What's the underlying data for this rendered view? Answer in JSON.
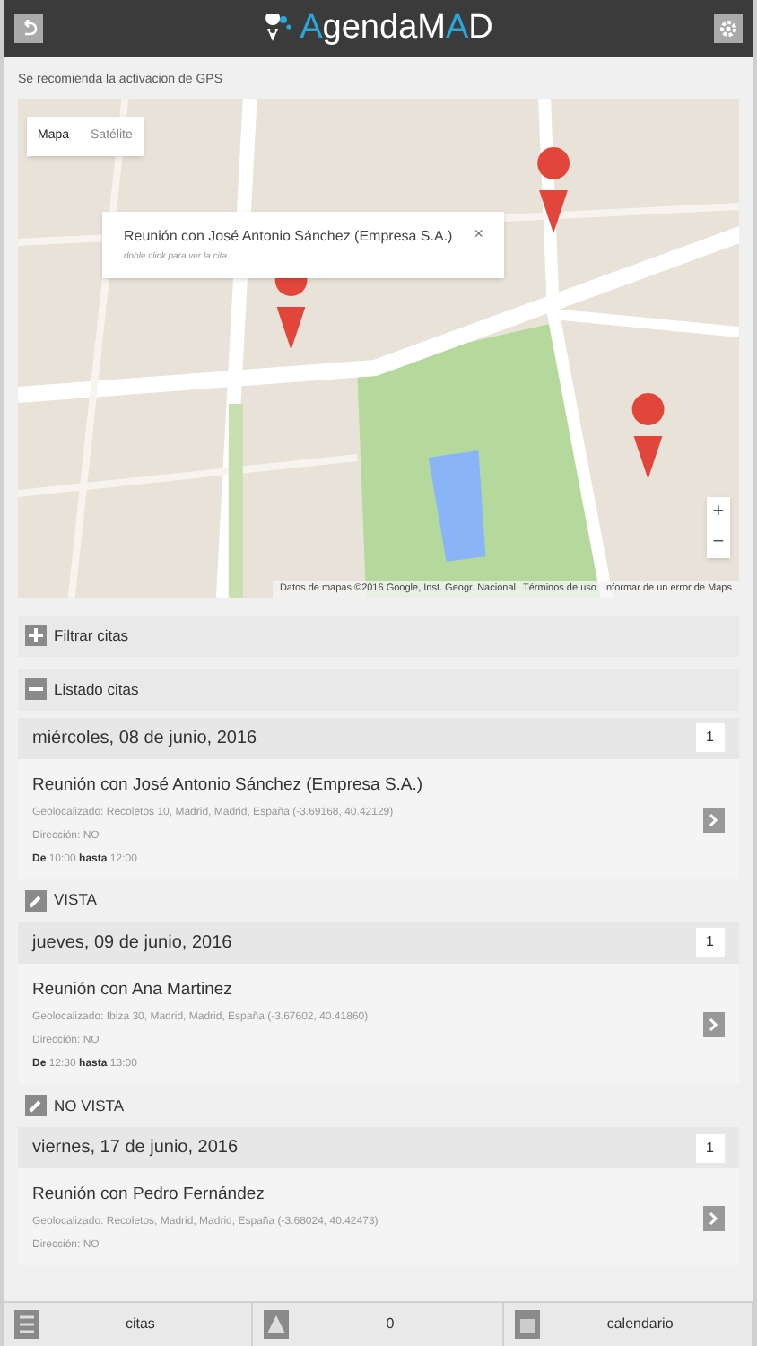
{
  "header": {
    "title_start": "A",
    "title_mid": "genda",
    "title_m": "M",
    "title_a": "A",
    "title_d": "D"
  },
  "gps_notice": "Se recomienda la activacion de GPS",
  "map": {
    "kind": "picture",
    "map_types": [
      {
        "label": "Mapa",
        "selected": true
      },
      {
        "label": "Satélite",
        "selected": false
      }
    ],
    "info_window": {
      "title": "Reunión con José Antonio Sánchez (Empresa S.A.)",
      "hint": "doble click para ver la cita",
      "close": "×"
    },
    "zoom_in": "+",
    "zoom_out": "−",
    "attribution": "Datos de mapas ©2016 Google, Inst. Geogr. Nacional",
    "terms": "Términos de uso",
    "report": "Informar de un error de Maps"
  },
  "panels": [
    {
      "label": "Filtrar citas",
      "expanded": false
    },
    {
      "label": "Listado citas",
      "expanded": true
    }
  ],
  "entries": [
    {
      "kind": "day",
      "date": "miércoles, 08 de junio, 2016",
      "count": "1",
      "title": "Reunión con José Antonio Sánchez (Empresa S.A.)",
      "geo": "Geolocalizado: Recoletos 10, Madrid, Madrid, España (-3.69168, 40.42129)",
      "address": "Dirección: NO",
      "from_label": "De",
      "from": "10:00",
      "to_label": "hasta",
      "to": "12:00"
    },
    {
      "kind": "status",
      "label": "VISTA"
    },
    {
      "kind": "day",
      "date": "jueves, 09 de junio, 2016",
      "count": "1",
      "title": "Reunión con Ana Martinez",
      "geo": "Geolocalizado: Ibiza 30, Madrid, Madrid, España (-3.67602, 40.41860)",
      "address": "Dirección: NO",
      "from_label": "De",
      "from": "12:30",
      "to_label": "hasta",
      "to": "13:00"
    },
    {
      "kind": "status",
      "label": "NO VISTA"
    },
    {
      "kind": "day",
      "date": "viernes, 17 de junio, 2016",
      "count": "1",
      "title": "Reunión con Pedro Fernández",
      "geo": "Geolocalizado: Recoletos, Madrid, Madrid, España (-3.68024, 40.42473)",
      "address": "Dirección: NO"
    }
  ],
  "footer": [
    {
      "kind": "list",
      "label": "citas"
    },
    {
      "kind": "alert",
      "label": "0"
    },
    {
      "kind": "calendar",
      "label": "calendario"
    }
  ]
}
